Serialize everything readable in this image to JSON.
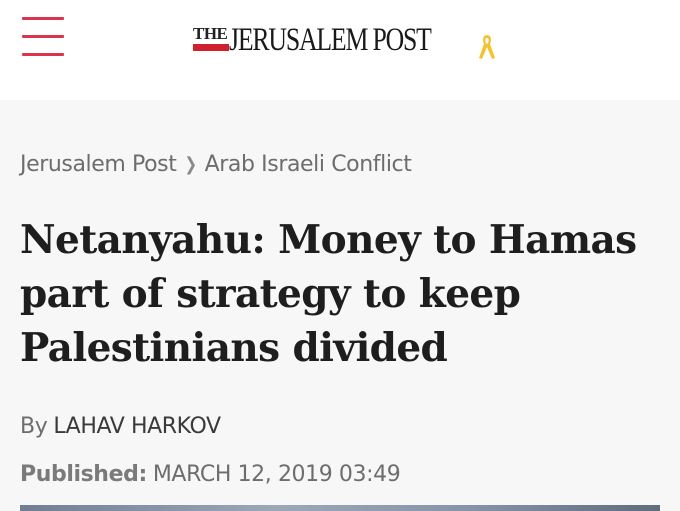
{
  "header": {
    "logo_the": "THE",
    "logo_name": "JERUSALEM POST",
    "accent_color": "#d9364d"
  },
  "breadcrumb": {
    "items": [
      "Jerusalem Post",
      "Arab Israeli Conflict"
    ],
    "separator_icon": "chevron-right-icon"
  },
  "article": {
    "headline": "Netanyahu: Money to Hamas part of strategy to keep Palestinians divided",
    "byline_prefix": "By",
    "author": "LAHAV HARKOV",
    "published_label": "Published:",
    "published_date": "MARCH 12, 2019 03:49"
  }
}
